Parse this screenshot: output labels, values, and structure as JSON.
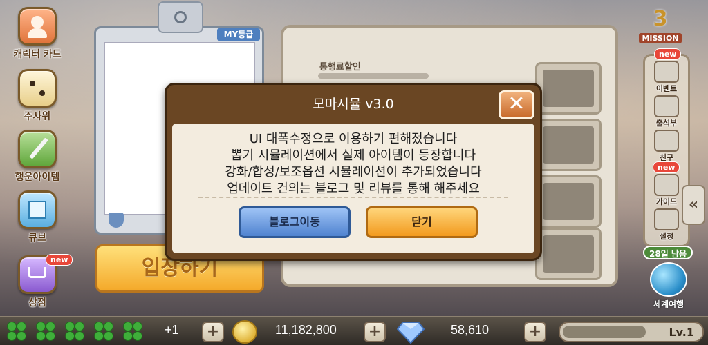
{
  "sidebar": {
    "items": [
      {
        "label": "캐릭터 카드",
        "icon": "character-card-icon"
      },
      {
        "label": "주사위",
        "icon": "dice-icon"
      },
      {
        "label": "행운아이템",
        "icon": "sword-icon"
      },
      {
        "label": "큐브",
        "icon": "cube-icon"
      },
      {
        "label": "상점",
        "icon": "cart-icon",
        "badge": "new"
      }
    ]
  },
  "card_panel": {
    "grade_label": "MY등급",
    "enter_label": "입장하기"
  },
  "right_panel": {
    "pass_discount_label": "통행료할인"
  },
  "right_sidebar": {
    "mission_number": "3",
    "mission_label": "MISSION",
    "mission_badge": "new",
    "items": [
      {
        "label": "이벤트",
        "icon": "megaphone-icon"
      },
      {
        "label": "출석부",
        "icon": "calendar-icon"
      },
      {
        "label": "친구",
        "icon": "friend-icon",
        "badge": "new"
      },
      {
        "label": "가이드",
        "icon": "book-icon"
      },
      {
        "label": "설정",
        "icon": "gear-icon"
      }
    ],
    "collapse_glyph": "«",
    "days_left": "28일 남음",
    "world_travel_label": "세계여행"
  },
  "bottom_bar": {
    "clover_count": 5,
    "clover_extra": "+1",
    "gold_amount": "11,182,800",
    "gem_amount": "58,610",
    "plus_glyph": "+",
    "level": "Lv.1"
  },
  "modal": {
    "title": "모마시뮬 v3.0",
    "close_glyph": "✕",
    "lines": [
      "UI 대폭수정으로 이용하기 편해졌습니다",
      "뽑기 시뮬레이션에서 실제 아이템이 등장합니다",
      "강화/합성/보조옵션 시뮬레이션이 추가되었습니다",
      "업데이트 건의는 블로그 및 리뷰를 통해 해주세요"
    ],
    "blog_button": "블로그이동",
    "close_button": "닫기"
  },
  "colors": {
    "modal_header": "#6a4623",
    "modal_body": "#f3ecdf",
    "blog_button": "#4f83d0",
    "close_button": "#f29a1e",
    "new_badge": "#e8473a"
  }
}
